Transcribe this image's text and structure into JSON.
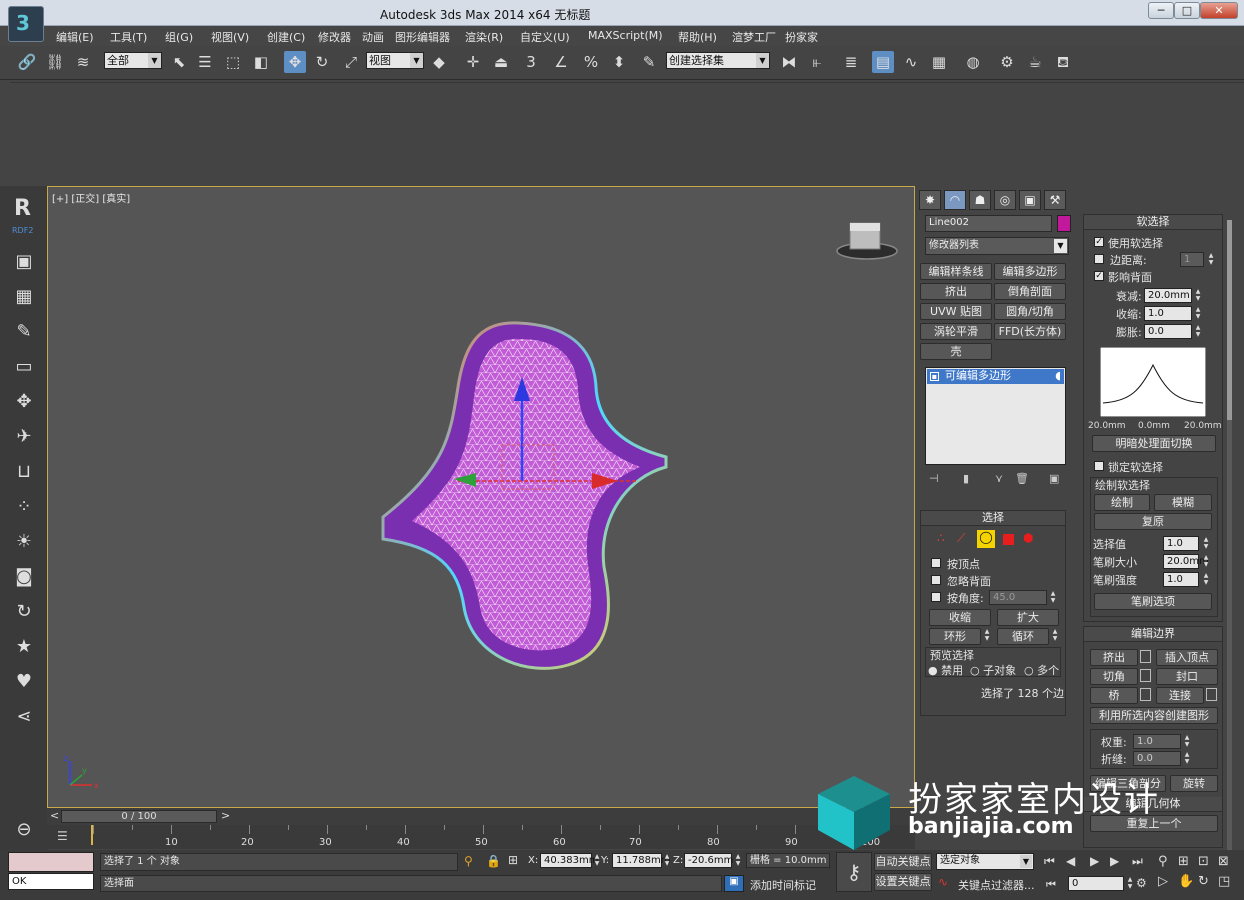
{
  "window": {
    "title": "Autodesk 3ds Max  2014 x64      无标题",
    "controls": [
      "─",
      "□",
      "✕"
    ]
  },
  "menu": [
    "编辑(E)",
    "工具(T)",
    "组(G)",
    "视图(V)",
    "创建(C)",
    "修改器",
    "动画",
    "图形编辑器",
    "渲染(R)",
    "自定义(U)",
    "MAXScript(M)",
    "帮助(H)",
    "渲梦工厂",
    "扮家家"
  ],
  "toolbar": {
    "selection_filter": "全部",
    "ref_coord": "视图",
    "named_selection": "创建选择集",
    "snap_labels": [
      "3",
      "∠",
      "%"
    ]
  },
  "sidebar": {
    "logo": "R",
    "logo_sub": "RDF2"
  },
  "viewport": {
    "label": "[+] [正交] [真实]",
    "axis": {
      "x": "x",
      "y": "y",
      "z": "z"
    }
  },
  "timeline": {
    "frame_display": "0 / 100",
    "ticks": [
      "10",
      "20",
      "30",
      "40",
      "50",
      "60",
      "70",
      "80",
      "90",
      "100"
    ],
    "prev": "<",
    "next": ">"
  },
  "command_panel": {
    "tabs": [
      "✸",
      "◠",
      "☗",
      "◎",
      "▣",
      "⚒"
    ],
    "object_name": "Line002",
    "object_color": "#c2189c",
    "modifier_list": "修改器列表",
    "modifier_buttons": [
      "编辑样条线",
      "编辑多边形",
      "挤出",
      "倒角剖面",
      "UVW 贴图",
      "圆角/切角",
      "涡轮平滑",
      "FFD(长方体)",
      "壳"
    ],
    "stack_item": "可编辑多边形",
    "selection": {
      "header": "选择",
      "by_vertex": "按顶点",
      "ignore_backfacing": "忽略背面",
      "by_angle": "按角度:",
      "angle_value": "45.0",
      "shrink": "收缩",
      "grow": "扩大",
      "ring": "环形",
      "loop": "循环",
      "preview_header": "预览选择",
      "preview_options": [
        "禁用",
        "子对象",
        "多个"
      ],
      "status": "选择了 128 个边"
    },
    "soft_selection": {
      "header": "软选择",
      "use_soft": "使用软选择",
      "edge_distance": "边距离:",
      "edge_distance_value": "1",
      "affect_backfacing": "影响背面",
      "falloff_label": "衰减:",
      "falloff": "20.0mm",
      "pinch_label": "收缩:",
      "pinch": "1.0",
      "bubble_label": "膨胀:",
      "bubble": "0.0",
      "curve_labels": [
        "20.0mm",
        "0.0mm",
        "20.0mm"
      ],
      "shaded_face_toggle": "明暗处理面切换",
      "lock": "锁定软选择",
      "paint_header": "绘制软选择",
      "paint": "绘制",
      "blur": "模糊",
      "revert": "复原",
      "sel_value_label": "选择值",
      "sel_value": "1.0",
      "brush_size_label": "笔刷大小",
      "brush_size": "20.0mm",
      "brush_strength_label": "笔刷强度",
      "brush_strength": "1.0",
      "brush_options": "笔刷选项"
    },
    "edit_edges": {
      "header": "编辑边界",
      "extrude": "挤出",
      "insert_vertex": "插入顶点",
      "chamfer": "切角",
      "cap": "封口",
      "bridge": "桥",
      "connect": "连接",
      "create_shape": "利用所选内容创建图形",
      "weight_label": "权重:",
      "weight": "1.0",
      "crease_label": "折缝:",
      "crease": "0.0",
      "edit_tri": "编辑三角剖分",
      "rotate": "旋转",
      "edit_geo": "编辑几何体",
      "repeat_last": "重复上一个"
    }
  },
  "status": {
    "listener": "OK",
    "selected": "选择了 1 个 对象",
    "prompt": "选择面",
    "x_label": "X:",
    "x": "40.383mm",
    "y_label": "Y:",
    "y": "11.788mm",
    "z_label": "Z:",
    "z": "-20.6mm",
    "grid": "栅格 = 10.0mm",
    "auto_key": "自动关键点",
    "set_key": "设置关键点",
    "key_mode": "选定对象",
    "key_filters": "关键点过滤器...",
    "add_tag": "添加时间标记",
    "frame": "0"
  },
  "watermark": {
    "text": "扮家家室内设计",
    "url": "banjiajia.com"
  }
}
